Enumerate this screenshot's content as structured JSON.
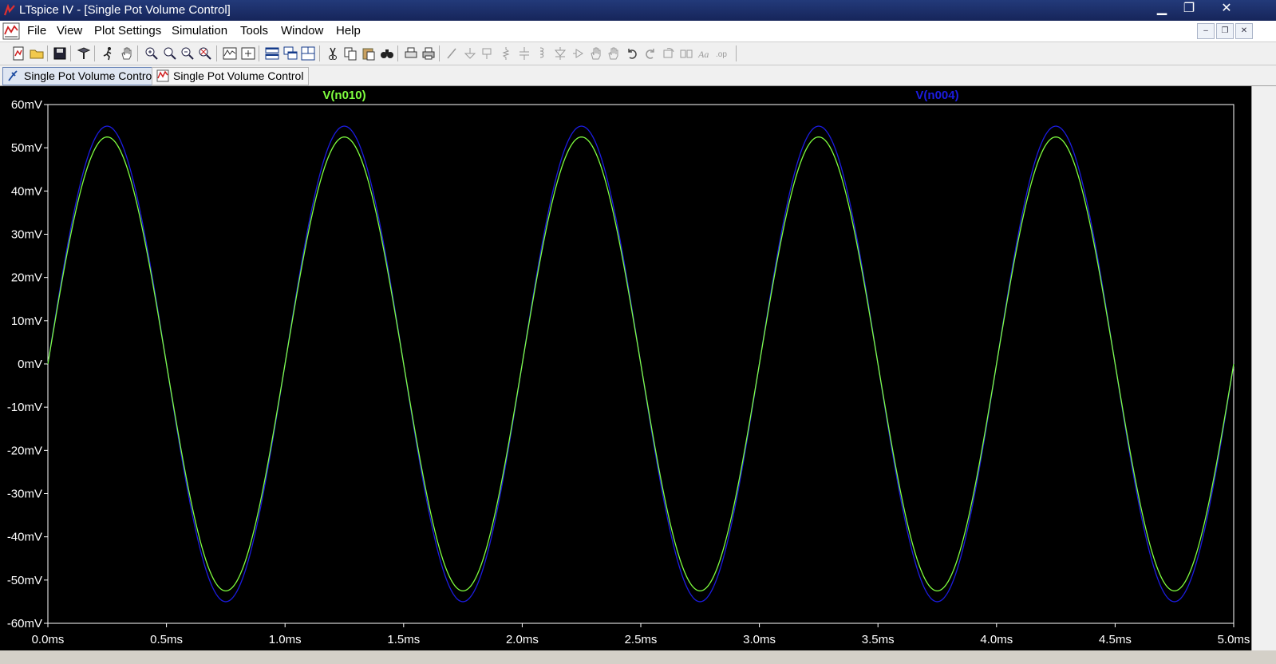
{
  "window": {
    "title": "LTspice IV - [Single Pot Volume Control]",
    "minimize": "▁",
    "maximize": "❐",
    "close": "✕"
  },
  "menu": [
    {
      "label": "File",
      "hotkey": "F"
    },
    {
      "label": "View",
      "hotkey": "V"
    },
    {
      "label": "Plot Settings",
      "hotkey": "P"
    },
    {
      "label": "Simulation",
      "hotkey": "S"
    },
    {
      "label": "Tools",
      "hotkey": "T"
    },
    {
      "label": "Window",
      "hotkey": "W"
    },
    {
      "label": "Help",
      "hotkey": "H"
    }
  ],
  "mdi_buttons": [
    "–",
    "❐",
    "✕"
  ],
  "toolbar": {
    "icons": [
      "new-schematic-icon",
      "open-icon",
      "save-icon",
      "control-panel-icon",
      "run-icon",
      "pan-icon",
      "zoom-in-icon",
      "zoom-area-icon",
      "zoom-out-icon",
      "zoom-fit-icon",
      "autoscale-icon",
      "add-trace-icon",
      "tile-horizontal-icon",
      "cascade-icon",
      "tile-icon",
      "cut-icon",
      "copy-icon",
      "paste-icon",
      "find-icon",
      "print-preview-icon",
      "print-icon",
      "wire-icon",
      "ground-icon",
      "label-net-icon",
      "resistor-icon",
      "capacitor-icon",
      "inductor-icon",
      "diode-icon",
      "component-icon",
      "move-icon",
      "drag-icon",
      "undo-icon",
      "redo-icon",
      "rotate-icon",
      "mirror-icon",
      "text-icon",
      "spice-directive-icon"
    ]
  },
  "tabs": [
    {
      "label": "Single Pot Volume Control",
      "icon": "schematic-icon",
      "active": true
    },
    {
      "label": "Single Pot Volume Control",
      "icon": "waveform-icon",
      "active": false
    }
  ],
  "colors": {
    "plot_bg": "#000000",
    "axis": "#ffffff",
    "trace1": "#7fff3f",
    "trace2": "#1c1ce0"
  },
  "chart_data": {
    "type": "line",
    "title": "",
    "x_tick_labels": [
      "0.0ms",
      "0.5ms",
      "1.0ms",
      "1.5ms",
      "2.0ms",
      "2.5ms",
      "3.0ms",
      "3.5ms",
      "4.0ms",
      "4.5ms",
      "5.0ms"
    ],
    "y_tick_labels": [
      "60mV",
      "50mV",
      "40mV",
      "30mV",
      "20mV",
      "10mV",
      "0mV",
      "-10mV",
      "-20mV",
      "-30mV",
      "-40mV",
      "-50mV",
      "-60mV"
    ],
    "xlim": [
      0,
      5.0
    ],
    "ylim": [
      -60,
      60
    ],
    "x_unit": "ms",
    "y_unit": "mV",
    "series": [
      {
        "name": "V(n010)",
        "color": "#7fff3f",
        "amplitude": 52.5,
        "frequency_khz": 1.0,
        "phase_deg": 0
      },
      {
        "name": "V(n004)",
        "color": "#1c1ce0",
        "amplitude": 55,
        "frequency_khz": 1.0,
        "phase_deg": 0
      }
    ]
  }
}
